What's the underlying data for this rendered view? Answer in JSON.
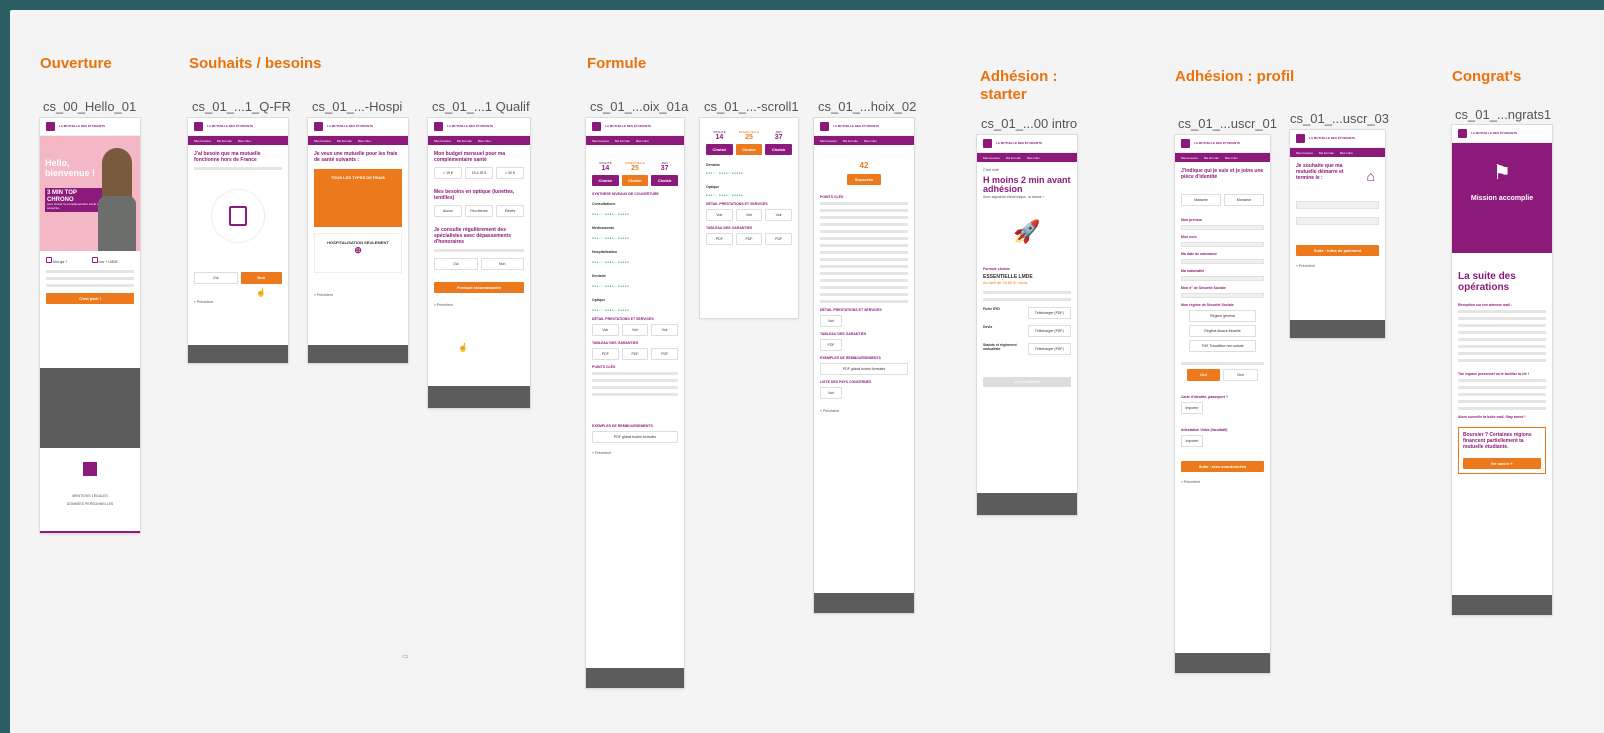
{
  "sections": {
    "ouverture": "Ouverture",
    "souhaits": "Souhaits / besoins",
    "formule": "Formule",
    "adhesion_starter": "Adhésion :\nstarter",
    "adhesion_profil": "Adhésion : profil",
    "congrats": "Congrat's"
  },
  "frames": {
    "f1": "cs_00_Hello_01",
    "f2": "cs_01_...1_Q-FR",
    "f3": "cs_01_...-Hospi",
    "f4": "cs_01_...1 Qualif",
    "f5": "cs_01_...oix_01a",
    "f6": "cs_01_...-scroll1",
    "f7": "cs_01_...hoix_02",
    "f8": "cs_01_...00 intro",
    "f9": "cs_01_...uscr_01",
    "f10": "cs_01_...uscr_03",
    "f11": "cs_01_...ngrats1"
  },
  "common": {
    "logo_text": "LA MUTUELLE DES ÉTUDIANTS",
    "nav": [
      "Mes besoins",
      "Ma formule",
      "Mes infos"
    ],
    "precedent": "« Précédent"
  },
  "hello": {
    "title": "Hello, bienvenue !",
    "chrono": "3 MIN TOP CHRONO",
    "chrono_sub": "pour choisir ta complémentaire santé et y souscrire.",
    "qui": "Moi qui ?",
    "lmde": "Les + LMDE",
    "cta": "C'est parti !",
    "legal": "MENTIONS LÉGALES",
    "perso": "DONNÉES PERSONNELLES"
  },
  "qfr": {
    "q": "J'ai besoin que ma mutuelle fonctionne hors de France",
    "oui": "Oui",
    "non": "Non"
  },
  "hospi": {
    "q": "Je veux une mutuelle pour les frais de santé suivants :",
    "all": "TOUS LES TYPES DE FRAIS",
    "hosp": "HOSPITALISATION SEULEMENT"
  },
  "qualif": {
    "q1": "Mon budget mensuel pour ma complémentaire santé",
    "budget": [
      "< 15 €",
      "15 à 30 €",
      "> 30 €"
    ],
    "q2": "Mes besoins en optique (lunettes, lentilles)",
    "optique": [
      "Aucun",
      "Peu élevés",
      "Élevés"
    ],
    "q3": "Je consulte régulièrement des spécialistes avec dépassements d'honoraires",
    "oui": "Oui",
    "non": "Non",
    "cta": "Formule recommandée"
  },
  "formule": {
    "plans": [
      "VITALITÉ",
      "ESSENTIELLE",
      "ZEN"
    ],
    "prices": [
      "14",
      "25",
      "37"
    ],
    "choisir": "Choisir",
    "synthese": "SYNTHÈSE NIVEAUX DE COUVERTURE",
    "rows": [
      "Consultations",
      "Médicaments",
      "Hospitalisation",
      "Dentaire",
      "Optique"
    ],
    "detail": "DÉTAIL PRESTATIONS ET SERVICES",
    "voir": "Voir",
    "tableau": "TABLEAU DES GARANTIES",
    "pdf": "PDF",
    "points": "POINTS CLÉS",
    "exemples": "EXEMPLES DE REMBOURSEMENTS",
    "pdf_global": "PDF global toutes formules"
  },
  "choix2": {
    "price": "42",
    "souscrire": "Souscrire",
    "points": "POINTS CLÉS",
    "liste": "LISTE DES PAYS CONCERNÉS"
  },
  "intro": {
    "hello": "C'est noté",
    "title": "H moins 2 min avant adhésion",
    "sub": "Avec signature électronique, la classe !",
    "formule": "Formule choisie",
    "name": "ESSENTIELLE LMDE",
    "tarif": "Au tarif de 25,60 € / mois",
    "docs": [
      "Fiche IPID",
      "Devis",
      "Statuts et règlement mutualiste"
    ],
    "dl": "Télécharger (PDF)",
    "cta": "Je veux adhérer"
  },
  "profil1": {
    "q": "J'indique qui je suis et je joins une pièce d'identité",
    "civ": [
      "Madame",
      "Monsieur"
    ],
    "fields": [
      "Mon prénom",
      "Mon nom",
      "Ma date de naissance",
      "Ma nationalité",
      "Mon n° de Sécurité Sociale",
      "Mon régime de Sécurité Sociale"
    ],
    "regimes": [
      "Régime général",
      "Régime Alsace Moselle",
      "TNS Travailleur non salarié"
    ],
    "oui": "Oui",
    "non": "Non",
    "carte": "Carte d'identité, passeport ?",
    "attest": "Attestation Vitale (facultatif)",
    "importer": "Importer",
    "cta": "Suite : mes coordonnées"
  },
  "profil3": {
    "q": "Je souhaite que ma mutuelle démarre et termine le :",
    "cta": "Suite : infos de paiement"
  },
  "congrats": {
    "mission": "Mission accomplie",
    "suite": "La suite des opérations",
    "reception": "Réception sur ton adresse mail :",
    "espace": "Ton espace personnel va te faciliter la vie !",
    "alors": "Alors surveille ta boite mail. Stay tuned !",
    "boursier": "Boursier ? Certaines régions financent partiellement ta mutuelle étudiante.",
    "savoir": "En savoir +"
  }
}
